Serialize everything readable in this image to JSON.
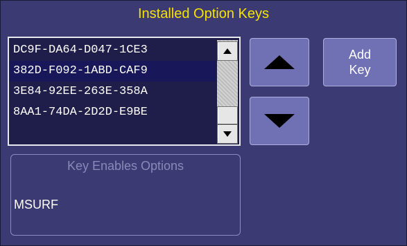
{
  "dialog": {
    "title": "Installed Option Keys"
  },
  "key_list": {
    "items": [
      {
        "text": "DC9F-DA64-D047-1CE3",
        "selected": false
      },
      {
        "text": "382D-F092-1ABD-CAF9",
        "selected": true
      },
      {
        "text": "3E84-92EE-263E-358A",
        "selected": false
      },
      {
        "text": "8AA1-74DA-2D2D-E9BE",
        "selected": false
      }
    ]
  },
  "buttons": {
    "add_key_line1": "Add",
    "add_key_line2": "Key",
    "scroll_up_icon": "triangle-up-icon",
    "scroll_down_icon": "triangle-down-icon"
  },
  "options_panel": {
    "label": "Key Enables Options",
    "value": "MSURF"
  },
  "colors": {
    "background": "#3b3a72",
    "title": "#f6e300",
    "button": "#7070b4",
    "list_background": "#1f1e4a",
    "selected_row": "#17175a",
    "disabled_label": "#8a89b8"
  }
}
